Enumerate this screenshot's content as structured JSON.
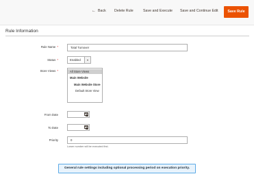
{
  "toolbar": {
    "back_label": "Back",
    "delete_label": "Delete Rule",
    "save_execute_label": "Save and Execute",
    "save_continue_label": "Save and Continue Edit",
    "save_label": "Save Rule",
    "accent_color": "#eb5202"
  },
  "section": {
    "title": "Rule Information"
  },
  "form": {
    "rule_name_label": "Rule Name",
    "rule_name_value": "Total Turnover",
    "status_label": "Status",
    "status_value": "Enabled",
    "store_views_label": "Store Views",
    "store_views_options": [
      "All Store Views",
      "Main Website",
      "Main Website Store",
      "Default Store View"
    ],
    "from_date_label": "From Date",
    "to_date_label": "To Date",
    "priority_label": "Priority",
    "priority_value": "0",
    "priority_note": "Lower number will be executed first."
  },
  "caption": "General rule settings including optional processing period on execution priority."
}
